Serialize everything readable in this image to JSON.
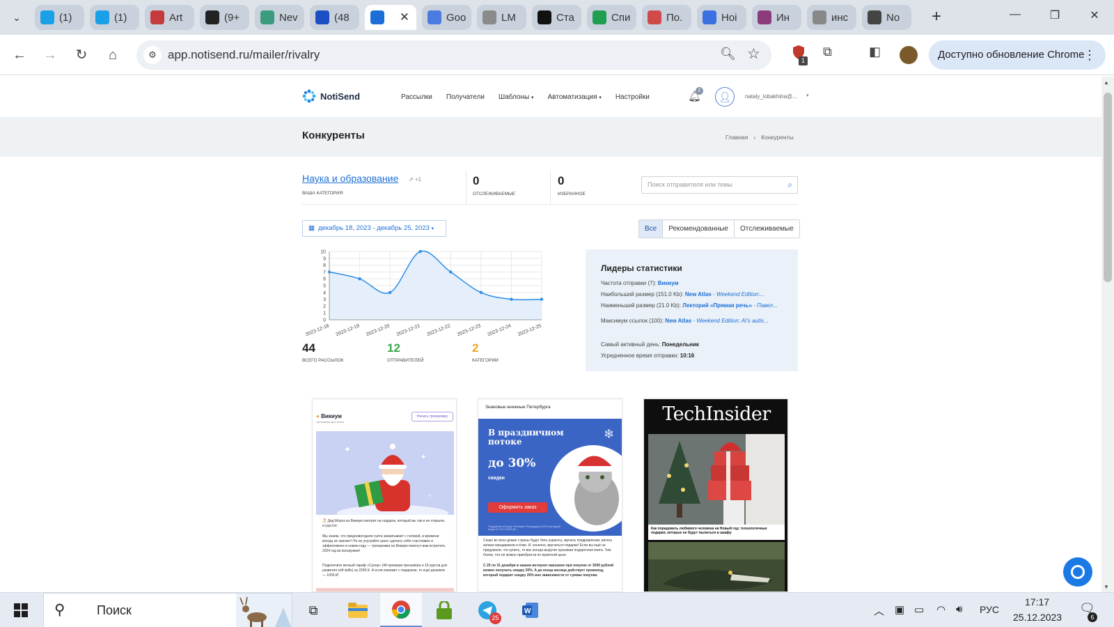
{
  "browser": {
    "tabs": [
      {
        "label": "(1)",
        "icon": "skype-icon",
        "color": "#1aa0e6"
      },
      {
        "label": "(1)",
        "icon": "skype-icon",
        "color": "#1aa0e6"
      },
      {
        "label": "Art",
        "icon": "calendar-icon",
        "color": "#c43b3b"
      },
      {
        "label": "(9+",
        "icon": "notion-icon",
        "color": "#222222"
      },
      {
        "label": "Nev",
        "icon": "openai-icon",
        "color": "#3a9c7d"
      },
      {
        "label": "(48",
        "icon": "mail-icon",
        "color": "#1d4fc4"
      },
      {
        "label": "",
        "icon": "notisend-icon",
        "color": "#1d6fd7",
        "active": true
      },
      {
        "label": "Goo",
        "icon": "translate-icon",
        "color": "#4a7be0"
      },
      {
        "label": "LM",
        "icon": "lm-icon",
        "color": "#8a8a8a"
      },
      {
        "label": "Ста",
        "icon": "star-icon",
        "color": "#111111"
      },
      {
        "label": "Спи",
        "icon": "sheets-icon",
        "color": "#1f9e4f"
      },
      {
        "label": "По.",
        "icon": "analytics-icon",
        "color": "#d04a4a"
      },
      {
        "label": "Ноі",
        "icon": "docs-icon",
        "color": "#3b70e0"
      },
      {
        "label": "Ин",
        "icon": "ai-icon",
        "color": "#8c3c7c"
      },
      {
        "label": "инс",
        "icon": "google-icon",
        "color": "#888888"
      },
      {
        "label": "No",
        "icon": "chat-icon",
        "color": "#444444"
      }
    ],
    "url": "app.notisend.ru/mailer/rivalry",
    "update_label": "Доступно обновление Chrome",
    "extension_badge": "1"
  },
  "site": {
    "brand": "NotiSend",
    "nav": [
      "Рассылки",
      "Получатели",
      "Шаблоны",
      "Автоматизация",
      "Настройки"
    ],
    "nav_dropdown_caret": "▾",
    "notifications_count": "2",
    "user": "nataly_lobakhina@...",
    "page_title": "Конкуренты",
    "breadcrumb": {
      "home": "Главная",
      "current": "Конкуренты"
    }
  },
  "summary": {
    "category": "Наука и образование",
    "category_extra": "+1",
    "category_label": "ВАША КАТЕГОРИЯ",
    "tracked_value": "0",
    "tracked_label": "ОТСЛЕЖИВАЕМЫЕ",
    "favorites_value": "0",
    "favorites_label": "ИЗБРАННОЕ",
    "search_placeholder": "Поиск отправителя или темы"
  },
  "date_range": "декабрь 18, 2023 - декабрь 25, 2023",
  "filters": [
    {
      "label": "Все",
      "active": true
    },
    {
      "label": "Рекомендованные",
      "active": false
    },
    {
      "label": "Отслеживаемые",
      "active": false
    }
  ],
  "chart_data": {
    "type": "area",
    "x": [
      "2023-12-18",
      "2023-12-19",
      "2023-12-20",
      "2023-12-21",
      "2023-12-22",
      "2023-12-23",
      "2023-12-24",
      "2023-12-25"
    ],
    "values": [
      7,
      6,
      4,
      10,
      7,
      4,
      3,
      3
    ],
    "ylim": [
      0,
      10
    ],
    "yticks": [
      0,
      1,
      2,
      3,
      4,
      5,
      6,
      7,
      8,
      9,
      10
    ],
    "grid": true,
    "color": "#2c8de6",
    "fill": "#e4effb"
  },
  "totals": [
    {
      "value": "44",
      "label": "ВСЕГО РАССЫЛОК",
      "color": "#222222"
    },
    {
      "value": "12",
      "label": "ОТПРАВИТЕЛЕЙ",
      "color": "#3aa64a"
    },
    {
      "value": "2",
      "label": "КАТЕГОРИИ",
      "color": "#f0a526"
    }
  ],
  "leaders": {
    "title": "Лидеры статистики",
    "freq_label": "Частота отправки (7): ",
    "freq_value": "Викиум",
    "max_size_label": "Наибольший размер (151.0 Kb): ",
    "max_size_sender": "New Atlas",
    "max_size_subject": " - Weekend Edition:...",
    "min_size_label": "Наименьший размер (21.0 Kb): ",
    "min_size_sender": "Лекторий «Прямая речь»",
    "min_size_subject": " - Павел...",
    "max_links_label": "Максимум ссылок (100): ",
    "max_links_sender": "New Atlas",
    "max_links_subject": " - Weekend Edition: AI's autis...",
    "active_day_label": "Самый активный день: ",
    "active_day_value": "Понедельник",
    "avg_time_label": "Усредненное время отправки: ",
    "avg_time_value": "10:16"
  },
  "cards": {
    "c1": {
      "logo": "Викиум",
      "logo_sub": "тренажеры для мозга",
      "button": "Начать тренировку",
      "p1": "🎅 Дед Мороз из Викиум смотрит на подарок, который вы так и не открыли, и грустит.",
      "p2": "Мы знаем, что предновогодняя суета захватывает с головой, и времени всегда не хватает! Но не упускайте шанс сделать себя счастливее и эффективнее в новом году — тренировки на Викиум помогут вам встретить 2024 год во всеоружии!",
      "p3": "Подключите вечный тариф «Супер» (44 премиум-тренажёра и 19 курсов для развития soft skills) за 2290 ₽. А если поможет с подарком, то ещё дешевле — 1000 ₽!"
    },
    "c2": {
      "head": "Знаковые книжные Петербурга",
      "h1": "В праздничном потоке",
      "h2": "до 30%",
      "h3": "скидки",
      "button": "Оформить заказ",
      "fine": "*Подробнее об акции: Регламент Распродажа 2023 Новогодний Акции ОТ 20.12.2023 ДО ...",
      "p1": "Скоро во всех домах страны будут бить куранты, звучать поздравления, витать запахи мандаринов и ёлки. И, конечно, вручаться подарки! Если вы ещё не придумали, что купить, то вас всегда выручит красивая подарочная книга. Тем более, что её можно приобрести по приятной цене.",
      "p2": "С 25 по 31 декабря в нашем интернет-магазине при покупке от 3000 рублей можно получить скидку 30%. А до конца месяца действует промокод, который подарит скидку 25% вне зависимости от суммы покупки."
    },
    "c3": {
      "title": "TechInsider",
      "caption": "Как порадовать любимого человека на Новый год: технологичные подарки, которые не будут пылиться в шкафу"
    }
  },
  "taskbar": {
    "search_label": "Поиск",
    "telegram_badge": "25",
    "lang": "РУС",
    "time": "17:17",
    "date": "25.12.2023",
    "notif_badge": "6"
  }
}
